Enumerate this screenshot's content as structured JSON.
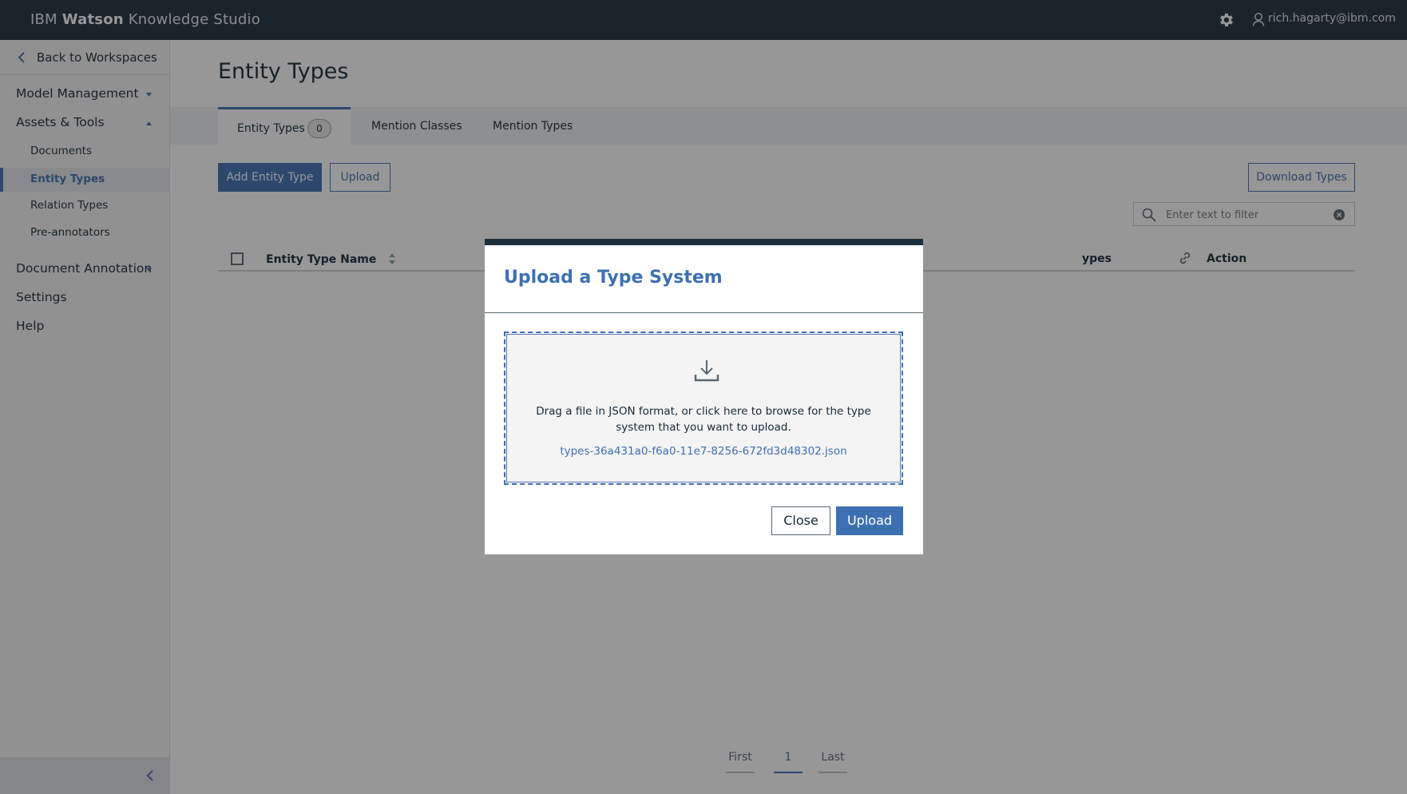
{
  "header": {
    "brand_prefix": "IBM",
    "brand_bold": "Watson",
    "brand_suffix": "Knowledge Studio",
    "user_email": "rich.hagarty@ibm.com"
  },
  "sidebar": {
    "back_label": "Back to Workspaces",
    "sections": [
      {
        "label": "Model Management"
      },
      {
        "label": "Assets & Tools"
      },
      {
        "label": "Document Annotation"
      },
      {
        "label": "Settings"
      },
      {
        "label": "Help"
      }
    ],
    "sub_items": [
      {
        "label": "Documents"
      },
      {
        "label": "Entity Types"
      },
      {
        "label": "Relation Types"
      },
      {
        "label": "Pre-annotators"
      }
    ]
  },
  "main": {
    "title": "Entity Types",
    "tabs": [
      {
        "label": "Entity Types",
        "count": "0"
      },
      {
        "label": "Mention Classes"
      },
      {
        "label": "Mention Types"
      }
    ],
    "add_button": "Add Entity Type",
    "upload_button": "Upload",
    "download_button": "Download Types",
    "filter_placeholder": "Enter text to filter",
    "columns": {
      "name": "Entity Type Name",
      "types_partial": "ypes",
      "action": "Action"
    },
    "pagination": {
      "first": "First",
      "current": "1",
      "last": "Last"
    }
  },
  "modal": {
    "title": "Upload a Type System",
    "instructions": "Drag a file in JSON format, or click here to browse for the type system that you want to upload.",
    "filename": "types-36a431a0-f6a0-11e7-8256-672fd3d48302.json",
    "close_button": "Close",
    "upload_button": "Upload"
  },
  "colors": {
    "accent": "#3d70b2",
    "header_bg": "#1c2f3d"
  }
}
